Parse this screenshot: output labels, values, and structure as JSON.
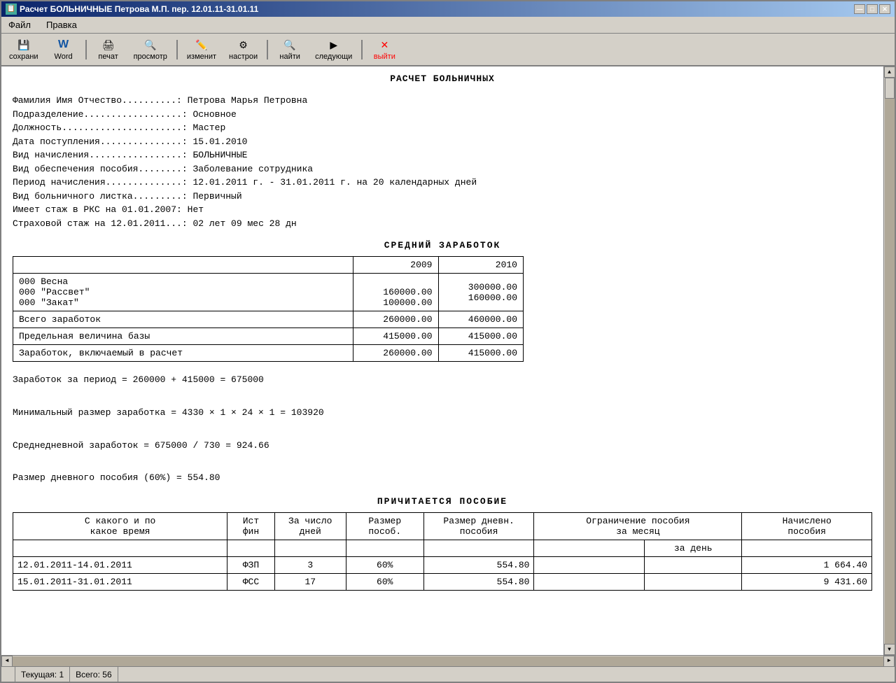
{
  "window": {
    "title": "Расчет БОЛЬНИЧНЫЕ Петрова М.П. пер. 12.01.11-31.01.11"
  },
  "titlebar": {
    "minimize": "—",
    "maximize": "□",
    "close": "✕"
  },
  "menubar": {
    "items": [
      "Файл",
      "Правка"
    ]
  },
  "toolbar": {
    "buttons": [
      {
        "icon": "💾",
        "label": "сохрани"
      },
      {
        "icon": "W",
        "label": "Word"
      },
      {
        "icon": "🖨",
        "label": "печат"
      },
      {
        "icon": "👁",
        "label": "просмотр"
      },
      {
        "icon": "✏️",
        "label": "изменит"
      },
      {
        "icon": "⚙",
        "label": "настрои"
      },
      {
        "icon": "🔍",
        "label": "найти"
      },
      {
        "icon": "▶",
        "label": "следующи"
      },
      {
        "icon": "✕",
        "label": "выйти"
      }
    ]
  },
  "document": {
    "main_title": "РАСЧЕТ БОЛЬНИЧНЫХ",
    "info": {
      "rows": [
        {
          "label": "Фамилия Имя Отчество..........: ",
          "value": "Петрова Марья Петровна"
        },
        {
          "label": "Подразделение..................: ",
          "value": "Основное"
        },
        {
          "label": "Должность......................: ",
          "value": "Мастер"
        },
        {
          "label": "Дата поступления...............: ",
          "value": "15.01.2010"
        },
        {
          "label": "Вид начисления.................: ",
          "value": "БОЛЬНИЧНЫЕ"
        },
        {
          "label": "Вид обеспечения пособия........: ",
          "value": "Заболевание сотрудника"
        },
        {
          "label": "Период начисления..............: ",
          "value": "12.01.2011 г. - 31.01.2011 г. на 20 календарных дней"
        },
        {
          "label": "Вид больничного листка.........: ",
          "value": "Первичный"
        },
        {
          "label": "Имеет стаж в РКС на 01.01.2007: ",
          "value": "Нет"
        },
        {
          "label": "Страховой стаж на 12.01.2011...: ",
          "value": "02 лет 09 мес 28 дн"
        }
      ]
    },
    "earnings_section": {
      "title": "СРЕДНИЙ   ЗАРАБОТОК",
      "col_header_empty": "",
      "col_2009": "2009",
      "col_2010": "2010",
      "rows": [
        {
          "desc": "000 Весна\n000 \"Рассвет\"\n000 \"Закат\"",
          "val2009": "\n160000.00\n100000.00",
          "val2010": "300000.00\n160000.00\n"
        },
        {
          "desc": "Всего заработок",
          "val2009": "260000.00",
          "val2010": "460000.00"
        },
        {
          "desc": "Предельная величина базы",
          "val2009": "415000.00",
          "val2010": "415000.00"
        },
        {
          "desc": "Заработок, включаемый в расчет",
          "val2009": "260000.00",
          "val2010": "415000.00"
        }
      ]
    },
    "calc_lines": [
      "Заработок за период = 260000 + 415000 = 675000",
      "Минимальный размер заработка = 4330 × 1 × 24 × 1 = 103920",
      "Среднедневной заработок    = 675000 / 730 = 924.66",
      "Размер дневного пособия (60%) = 554.80"
    ],
    "benefit_section": {
      "title": "ПРИЧИТАЕТСЯ ПОСОБИЕ",
      "headers": {
        "period": "С какого и по какое время",
        "source": "Ист фин",
        "days_count": "За число дней",
        "benefit_size": "Размер пособ.",
        "daily_benefit": "Размер дневн. пособия",
        "limit_month": "Ограничение пособия за месяц",
        "limit_day": "за день",
        "accrued": "Начислено пособия"
      },
      "rows": [
        {
          "period": "12.01.2011-14.01.2011",
          "source": "ФЗП",
          "days": "3",
          "pct": "60%",
          "daily": "554.80",
          "lim_month": "",
          "lim_day": "",
          "accrued": "1 664.40"
        },
        {
          "period": "15.01.2011-31.01.2011",
          "source": "ФСС",
          "days": "17",
          "pct": "60%",
          "daily": "554.80",
          "lim_month": "",
          "lim_day": "",
          "accrued": "9 431.60"
        }
      ]
    }
  },
  "statusbar": {
    "current_label": "Текущая:",
    "current_value": "1",
    "total_label": "Всего:",
    "total_value": "56"
  }
}
